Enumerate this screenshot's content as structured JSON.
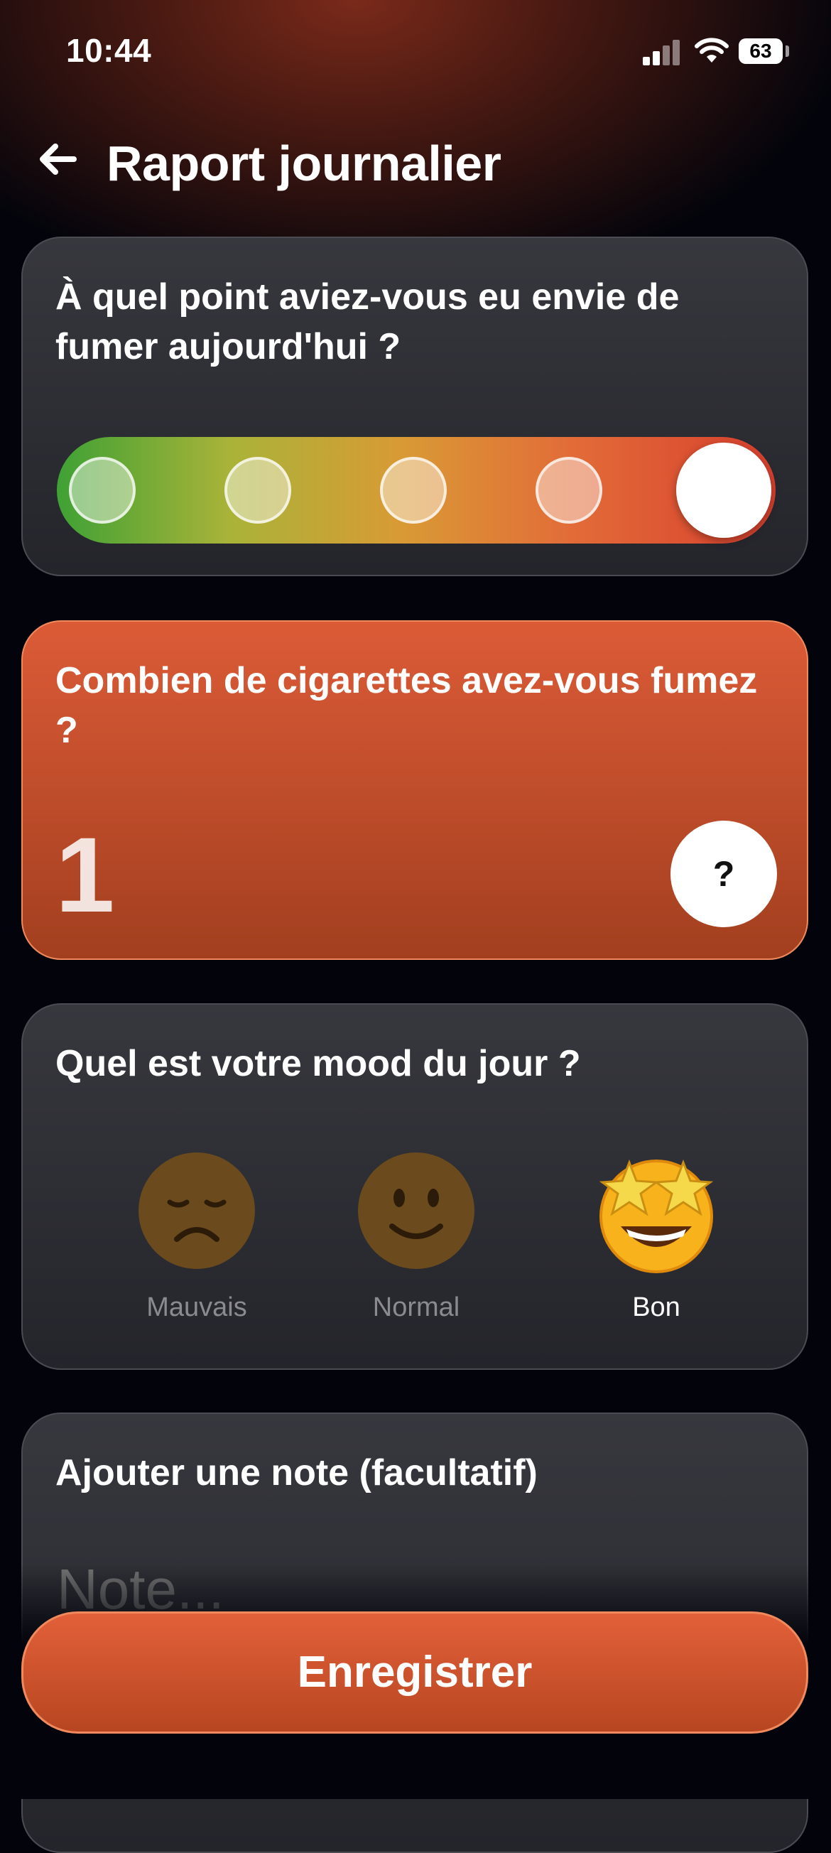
{
  "status_bar": {
    "time": "10:44",
    "battery": "63",
    "icons": [
      "cellular-signal-icon",
      "wifi-icon",
      "battery-icon"
    ]
  },
  "header": {
    "back_icon": "arrow-left-icon",
    "title": "Raport journalier"
  },
  "craving": {
    "question": "À quel point aviez-vous eu envie de fumer aujourd'hui ?",
    "levels": 5,
    "selected_level": 5,
    "gradient_colors": [
      "#3fa135",
      "#a9b338",
      "#d99a35",
      "#e26b38",
      "#d8402e"
    ]
  },
  "cigarettes": {
    "question": "Combien de cigarettes avez-vous fumez ?",
    "count": "1",
    "help_label": "?",
    "card_color": "#dc5b37"
  },
  "mood": {
    "question": "Quel est votre mood du jour ?",
    "options": [
      {
        "label": "Mauvais",
        "icon": "disappointed-face-icon",
        "selected": false
      },
      {
        "label": "Normal",
        "icon": "slightly-smiling-face-icon",
        "selected": false
      },
      {
        "label": "Bon",
        "icon": "star-struck-face-icon",
        "selected": true
      }
    ]
  },
  "note": {
    "title": "Ajouter une note (facultatif)",
    "placeholder": "Note..."
  },
  "save_button": {
    "label": "Enregistrer"
  },
  "colors": {
    "background": "#03040b",
    "accent": "#dc5b37",
    "card": "#2f2f36"
  }
}
